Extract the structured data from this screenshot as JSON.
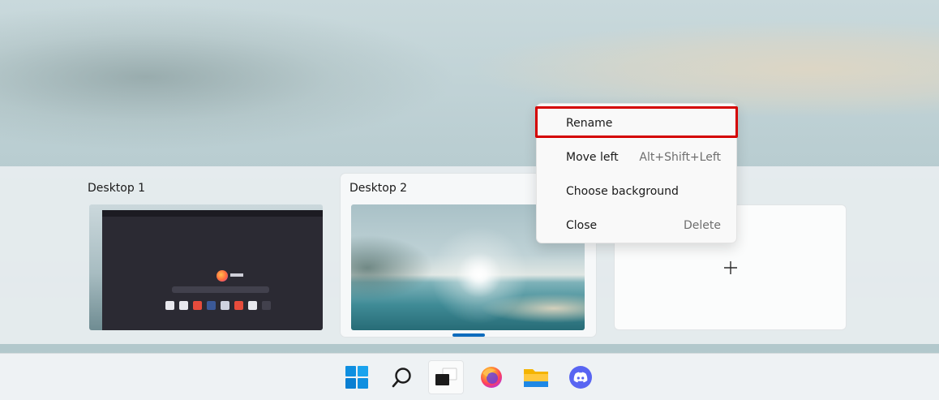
{
  "desktops": [
    {
      "label": "Desktop 1"
    },
    {
      "label": "Desktop 2"
    }
  ],
  "new_desktop": {
    "icon": "plus-icon"
  },
  "context_menu": {
    "items": [
      {
        "label": "Rename",
        "shortcut": ""
      },
      {
        "label": "Move left",
        "shortcut": "Alt+Shift+Left"
      },
      {
        "label": "Choose background",
        "shortcut": ""
      },
      {
        "label": "Close",
        "shortcut": "Delete"
      }
    ],
    "highlighted_item": "Rename"
  },
  "taskbar": {
    "icons": [
      "windows-start-icon",
      "search-icon",
      "task-view-icon",
      "firefox-icon",
      "file-explorer-icon",
      "discord-icon"
    ]
  },
  "colors": {
    "accent": "#0f6cbd",
    "highlight_border": "#d40000",
    "windows_blue": "#0078d4",
    "discord": "#5865f2"
  }
}
